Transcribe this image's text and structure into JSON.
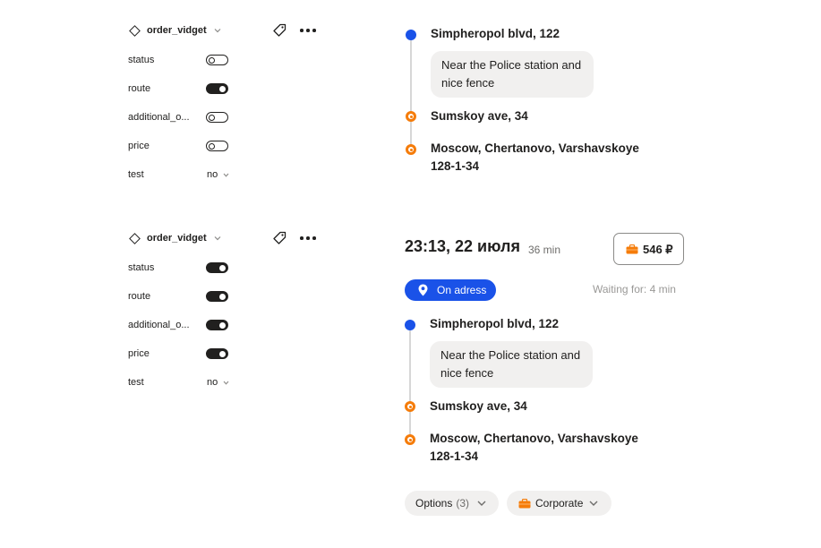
{
  "panels": [
    {
      "component": "order_vidget",
      "props": [
        {
          "label": "status",
          "type": "toggle",
          "on": false
        },
        {
          "label": "route",
          "type": "toggle",
          "on": true
        },
        {
          "label": "additional_o...",
          "type": "toggle",
          "on": false
        },
        {
          "label": "price",
          "type": "toggle",
          "on": false
        },
        {
          "label": "test",
          "type": "select",
          "value": "no"
        }
      ]
    },
    {
      "component": "order_vidget",
      "props": [
        {
          "label": "status",
          "type": "toggle",
          "on": true
        },
        {
          "label": "route",
          "type": "toggle",
          "on": true
        },
        {
          "label": "additional_o...",
          "type": "toggle",
          "on": true
        },
        {
          "label": "price",
          "type": "toggle",
          "on": true
        },
        {
          "label": "test",
          "type": "select",
          "value": "no"
        }
      ]
    }
  ],
  "route_preview": {
    "points": [
      {
        "address": "Simpheropol blvd, 122",
        "comment_line1": "Near the Police station and",
        "comment_line2": "nice fence"
      },
      {
        "address": "Sumskoy ave, 34"
      },
      {
        "address_line1": "Moscow, Chertanovo, Varshavskoye",
        "address_line2": "128-1-34"
      }
    ]
  },
  "order": {
    "time": "23:13, 22 июля",
    "duration": "36 min",
    "price": "546 ₽",
    "status": "On adress",
    "waiting": "Waiting for: 4 min",
    "route": {
      "points": [
        {
          "address": "Simpheropol blvd, 122",
          "comment_line1": "Near the Police station and",
          "comment_line2": "nice fence"
        },
        {
          "address": "Sumskoy ave, 34"
        },
        {
          "address_line1": "Moscow, Chertanovo, Varshavskoye",
          "address_line2": "128-1-34"
        }
      ]
    },
    "options_label": "Options",
    "options_count": "(3)",
    "tariff_label": "Corporate"
  },
  "colors": {
    "primary_blue": "#1a52e8",
    "route_orange": "#f57c0a",
    "text": "#21201f",
    "chip_bg": "#f1f0ef"
  },
  "icons": {
    "component": "diamond-icon",
    "tag": "tag-icon",
    "more": "more-dots-icon",
    "status": "location-pin-icon",
    "payment": "briefcase-icon",
    "expand": "chevron-down-icon"
  }
}
